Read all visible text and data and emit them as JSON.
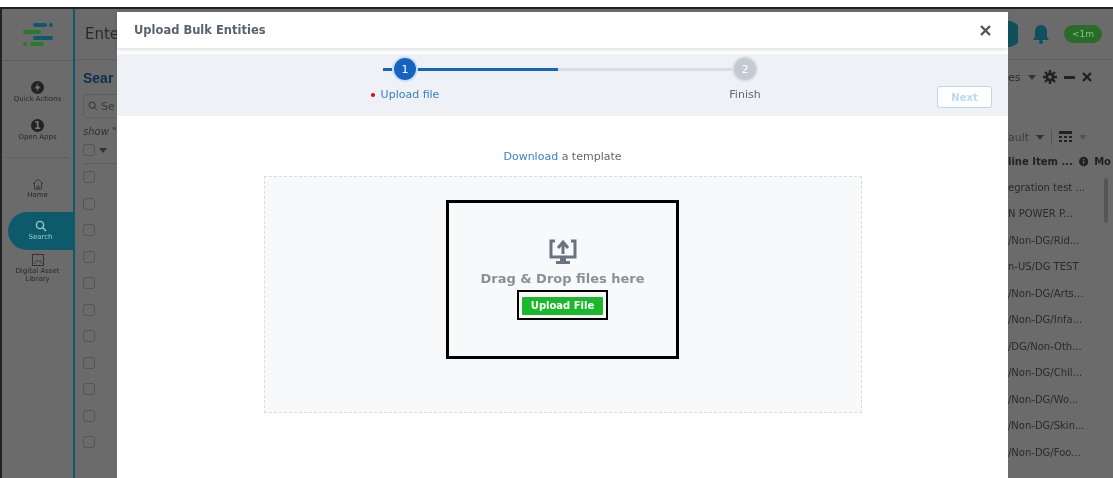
{
  "app": {
    "title": "Ente",
    "sidebar": [
      {
        "kind": "quick",
        "label": "Quick Actions",
        "selected": false
      },
      {
        "kind": "apps",
        "label": "Open Apps",
        "badge": "1",
        "selected": false
      },
      {
        "kind": "home",
        "label": "Home",
        "selected": false
      },
      {
        "kind": "search",
        "label": "Search",
        "selected": true
      },
      {
        "kind": "library",
        "label": "Digital Asset Library",
        "selected": false
      }
    ],
    "page_title": "Sear",
    "search": {
      "placeholder": "Se"
    },
    "filter_text": "show \"",
    "header_checkbox": {
      "checked": false
    },
    "rows": [
      {
        "checked": false,
        "column_2": "egration test ..."
      },
      {
        "checked": false,
        "column_2": "N POWER P..."
      },
      {
        "checked": false,
        "column_2": "/Non-DG/Rid..."
      },
      {
        "checked": false,
        "column_2": "n-US/DG TEST"
      },
      {
        "checked": false,
        "column_2": "/Non-DG/Arts..."
      },
      {
        "checked": false,
        "column_2": "/Non-DG/Infa..."
      },
      {
        "checked": false,
        "column_2": "/DG/Non-Oth..."
      },
      {
        "checked": false,
        "column_2": "/Non-DG/Chil..."
      },
      {
        "checked": false,
        "column_2": "/Non-DG/Wo..."
      },
      {
        "checked": false,
        "column_2": "/Non-DG/Skin..."
      },
      {
        "checked": false,
        "column_2": "/Non-DG/Foo..."
      }
    ],
    "view_menu": "es",
    "view_select": "ault",
    "columns": [
      "line Item ...",
      "Mo"
    ],
    "time_badge": "<1m"
  },
  "modal": {
    "title": "Upload Bulk Entities",
    "steps": [
      {
        "number": "1",
        "label": "Upload file",
        "selected": true,
        "required": true
      },
      {
        "number": "2",
        "label": "Finish",
        "selected": false,
        "required": false
      }
    ],
    "progress": {
      "level": 0.5
    },
    "next_button": {
      "label": "Next",
      "disabled": true
    },
    "template": {
      "link": "Download",
      "text": " a template"
    },
    "dropzone": {
      "text": "Drag & Drop files here",
      "button": "Upload File"
    }
  }
}
